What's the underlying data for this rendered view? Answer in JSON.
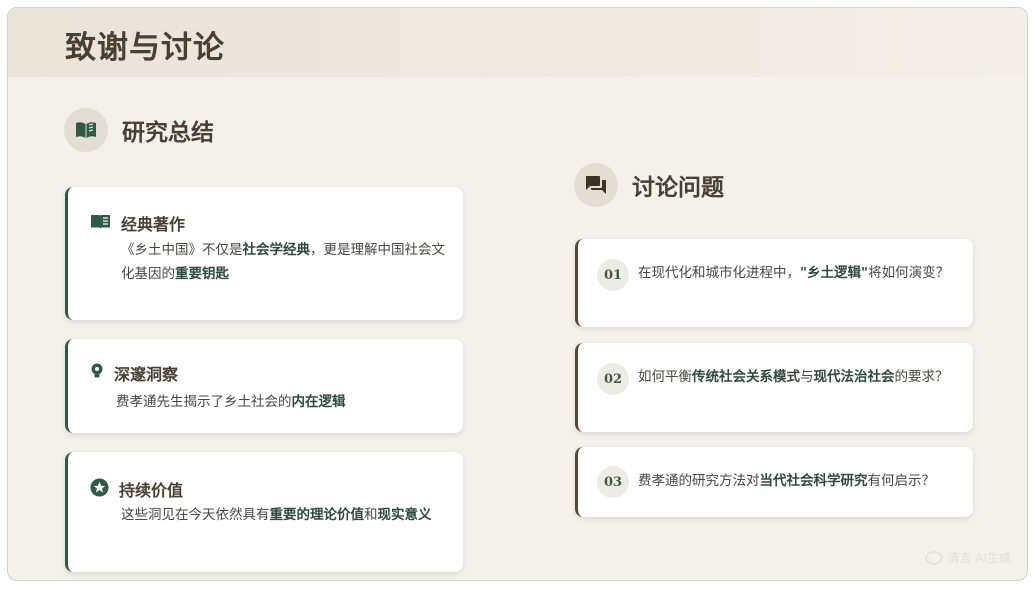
{
  "page_title": "致谢与讨论",
  "summary": {
    "title": "研究总结",
    "icon": "open-book-icon",
    "cards": [
      {
        "icon": "book-icon",
        "title": "经典著作",
        "parts": [
          {
            "text": "《乡土中国》不仅是",
            "bold": false
          },
          {
            "text": "社会学经典",
            "bold": true
          },
          {
            "text": "，更是理解中国社会文化基因的",
            "bold": false
          },
          {
            "text": "重要钥匙",
            "bold": true
          }
        ]
      },
      {
        "icon": "lightbulb-icon",
        "title": "深邃洞察",
        "parts": [
          {
            "text": "费孝通先生揭示了乡土社会的",
            "bold": false
          },
          {
            "text": "内在逻辑",
            "bold": true
          }
        ]
      },
      {
        "icon": "star-icon",
        "title": "持续价值",
        "parts": [
          {
            "text": "这些洞见在今天依然具有",
            "bold": false
          },
          {
            "text": "重要的理论价值",
            "bold": true
          },
          {
            "text": "和",
            "bold": false
          },
          {
            "text": "现实意义",
            "bold": true
          }
        ]
      }
    ]
  },
  "discussion": {
    "title": "讨论问题",
    "icon": "chat-icon",
    "questions": [
      {
        "num": "01",
        "parts": [
          {
            "text": "在现代化和城市化进程中，",
            "bold": false
          },
          {
            "text": "\"乡土逻辑\"",
            "bold": true
          },
          {
            "text": "将如何演变？",
            "bold": false
          }
        ]
      },
      {
        "num": "02",
        "parts": [
          {
            "text": "如何平衡",
            "bold": false
          },
          {
            "text": "传统社会关系模式",
            "bold": true
          },
          {
            "text": "与",
            "bold": false
          },
          {
            "text": "现代法治社会",
            "bold": true
          },
          {
            "text": "的要求？",
            "bold": false
          }
        ]
      },
      {
        "num": "03",
        "parts": [
          {
            "text": "费孝通的研究方法对",
            "bold": false
          },
          {
            "text": "当代社会科学研究",
            "bold": true
          },
          {
            "text": "有何启示？",
            "bold": false
          }
        ]
      }
    ]
  },
  "watermark": "清言 AI生成",
  "colors": {
    "background": "#f4f1ea",
    "accent_green": "#2f5a45",
    "accent_brown": "#5a4632",
    "title_text": "#4a3f33"
  }
}
